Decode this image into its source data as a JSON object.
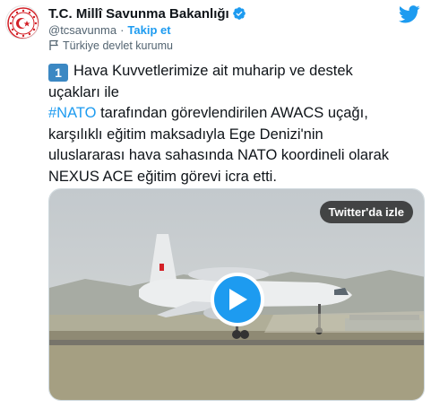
{
  "account": {
    "display_name": "T.C. Millî Savunma Bakanlığı",
    "handle": "@tcsavunma",
    "separator": "·",
    "follow_label": "Takip et",
    "state_label": "Türkiye devlet kurumu"
  },
  "tweet": {
    "badge": "1",
    "lines": [
      "Hava Kuvvetlerimize ait muharip ve destek",
      "uçakları ile",
      "#NATO",
      " tarafından görevlendirilen AWACS uçağı,",
      "karşılıklı eğitim maksadıyla Ege Denizi'nin",
      "uluslararası hava sahasında NATO koordineli olarak",
      "NEXUS ACE eğitim görevi icra etti."
    ]
  },
  "media": {
    "watch_label": "Twitter'da izle"
  },
  "colors": {
    "accent": "#1d9bf0",
    "badge": "#3b88c3",
    "seal_red": "#d32027"
  },
  "icons": [
    "seal-logo",
    "verified-badge-icon",
    "twitter-bird-icon",
    "flag-icon",
    "play-icon"
  ]
}
